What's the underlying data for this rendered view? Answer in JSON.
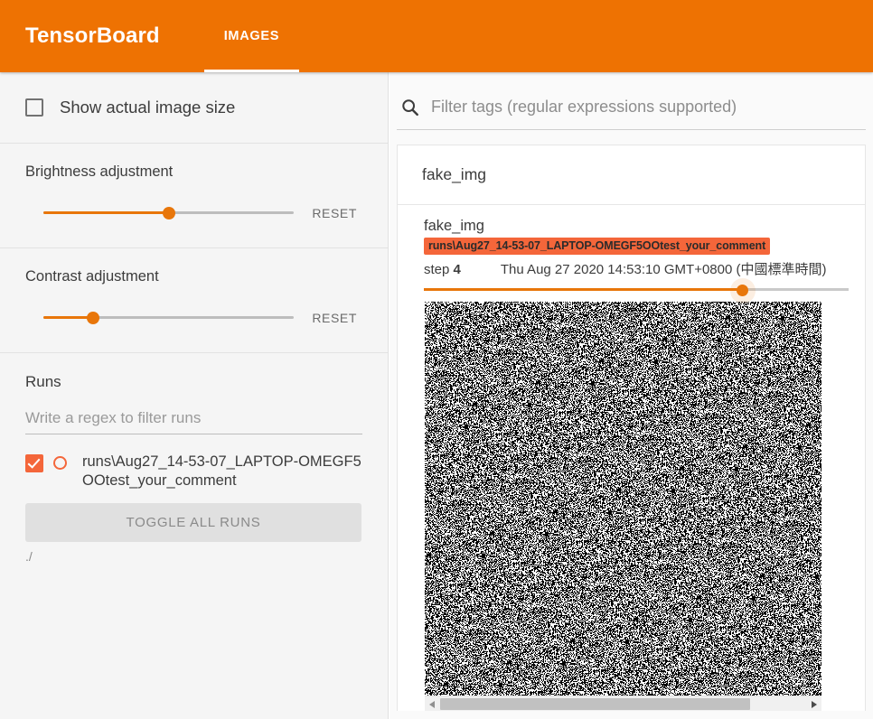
{
  "header": {
    "brand": "TensorBoard",
    "tabs": [
      {
        "label": "IMAGES",
        "active": true
      }
    ]
  },
  "sidebar": {
    "show_actual_size": {
      "label": "Show actual image size",
      "checked": false
    },
    "brightness": {
      "title": "Brightness adjustment",
      "reset_label": "RESET",
      "value_percent": 50
    },
    "contrast": {
      "title": "Contrast adjustment",
      "reset_label": "RESET",
      "value_percent": 20
    },
    "runs": {
      "title": "Runs",
      "filter_placeholder": "Write a regex to filter runs",
      "filter_value": "",
      "items": [
        {
          "name": "runs\\Aug27_14-53-07_LAPTOP-OMEGF5OOtest_your_comment",
          "checked": true
        }
      ],
      "toggle_all_label": "TOGGLE ALL RUNS",
      "logdir": "./"
    }
  },
  "main": {
    "filter": {
      "placeholder": "Filter tags (regular expressions supported)",
      "value": "",
      "icon": "search-icon"
    },
    "tag_groups": [
      {
        "name": "fake_img",
        "cards": [
          {
            "title": "fake_img",
            "run_badge": "runs\\Aug27_14-53-07_LAPTOP-OMEGF5OOtest_your_comment",
            "step_label": "step",
            "step_value": "4",
            "timestamp": "Thu Aug 27 2020 14:53:10 GMT+0800 (中國標準時間)",
            "step_slider_percent": 75,
            "image_alt": "random-noise-image"
          }
        ]
      }
    ],
    "scrollbar": {
      "left_arrow": "scroll-left-arrow",
      "right_arrow": "scroll-right-arrow",
      "thumb_percent": 83
    }
  },
  "colors": {
    "brand_orange": "#ee7202",
    "accent_orange": "#e8760a",
    "run_color": "#f4663a",
    "sidebar_bg": "#f5f5f5",
    "panel_bg": "#fafafa"
  }
}
